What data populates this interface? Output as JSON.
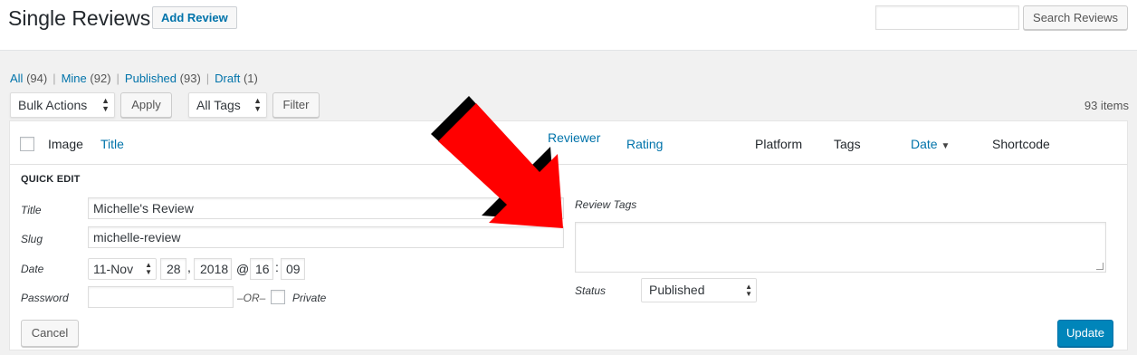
{
  "header": {
    "title": "Single Reviews",
    "add_button": "Add Review",
    "search_placeholder": "",
    "search_button": "Search Reviews"
  },
  "views": [
    {
      "label": "All",
      "count": "(94)"
    },
    {
      "label": "Mine",
      "count": "(92)"
    },
    {
      "label": "Published",
      "count": "(93)"
    },
    {
      "label": "Draft",
      "count": "(1)"
    }
  ],
  "toolbar": {
    "bulk_actions": "Bulk Actions",
    "apply": "Apply",
    "all_tags": "All Tags",
    "filter": "Filter",
    "items_count": "93 items"
  },
  "columns": {
    "image": "Image",
    "title": "Title",
    "reviewer": "Reviewer",
    "rating": "Rating",
    "platform": "Platform",
    "tags": "Tags",
    "date": "Date",
    "shortcode": "Shortcode"
  },
  "quick_edit": {
    "heading": "QUICK EDIT",
    "title_label": "Title",
    "title_value": "Michelle's Review",
    "slug_label": "Slug",
    "slug_value": "michelle-review",
    "date_label": "Date",
    "month": "11-Nov",
    "day": "28",
    "year": "2018",
    "at": "@",
    "hour": "16",
    "colon": ":",
    "minute": "09",
    "comma": ",",
    "password_label": "Password",
    "password_value": "",
    "or": "–OR–",
    "private_label": "Private",
    "review_tags_label": "Review Tags",
    "status_label": "Status",
    "status_value": "Published",
    "cancel": "Cancel",
    "update": "Update"
  },
  "colors": {
    "link": "#0073aa",
    "primary_button": "#0085ba",
    "arrow_fill": "#ff0000",
    "arrow_shadow": "#000000"
  }
}
